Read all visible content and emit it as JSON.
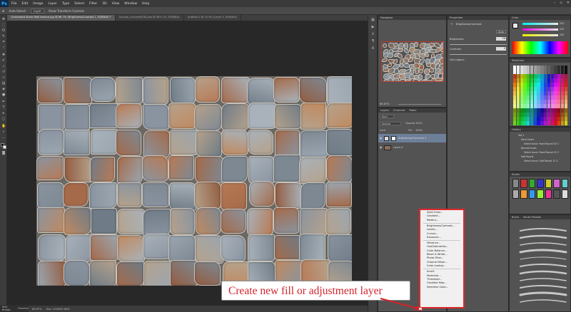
{
  "menubar": {
    "logo": "Ps",
    "items": [
      "File",
      "Edit",
      "Image",
      "Layer",
      "Type",
      "Select",
      "Filter",
      "3D",
      "View",
      "Window",
      "Help"
    ],
    "window_controls": [
      "–",
      "▫",
      "✕"
    ]
  },
  "options": {
    "items": [
      "Auto-Select:",
      "Layer",
      "Show Transform Controls"
    ]
  },
  "tabs": [
    {
      "label": "Contrasted Stone Wall texture.jpg @ 66.7% (Brightness/Contrast 1, RGB/8#) *",
      "active": true
    },
    {
      "label": "Grunge_Concrete[T6].psd @ 58% (T1, RGB/8#)",
      "active": false
    },
    {
      "label": "Untitled-1 @ 13.3% (Layer 1, RGB/8#)",
      "active": false
    }
  ],
  "status": {
    "zoom": "66.67%",
    "doc": "Doc: 4.80M/9.60M",
    "bottom_tab": "Mini Bridge",
    "bottom_tab2": "Timeline"
  },
  "navigator": {
    "title": "Navigator",
    "zoom": "66.67%"
  },
  "layers": {
    "tabs": [
      "Layers",
      "Channels",
      "Paths"
    ],
    "kind": "Kind",
    "blend": "Normal",
    "opacity_label": "Opacity:",
    "opacity": "100%",
    "lock_label": "Lock:",
    "fill_label": "Fill:",
    "fill": "100%",
    "rows": [
      {
        "name": "Brightness/Contrast 1"
      },
      {
        "name": "Layer 0"
      }
    ]
  },
  "properties": {
    "title": "Properties",
    "subtitle": "Brightness/Contrast",
    "auto": "Auto",
    "brightness_label": "Brightness:",
    "brightness": "28",
    "contrast_label": "Contrast:",
    "contrast": "0",
    "legacy": "Use Legacy"
  },
  "color": {
    "title": "Color",
    "r": "232",
    "g": "232",
    "b": "232"
  },
  "swatches": {
    "title": "Swatches"
  },
  "history": {
    "title": "History",
    "items": [
      "Set 1",
      "Hard Invert",
      "Select brush 'Hard Round 30 1'",
      "Normal brush",
      "Select brush 'Hard Round 13 1'",
      "Soft Round",
      "Select brush 'Soft Round 13 1'"
    ]
  },
  "styles": {
    "title": "Styles"
  },
  "brush": {
    "tabs": [
      "Brush",
      "Brush Presets"
    ]
  },
  "menu": {
    "groups": [
      [
        "Solid Color...",
        "Gradient...",
        "Pattern..."
      ],
      [
        "Brightness/Contrast...",
        "Levels...",
        "Curves...",
        "Exposure..."
      ],
      [
        "Vibrance...",
        "Hue/Saturation...",
        "Color Balance...",
        "Black & White...",
        "Photo Filter...",
        "Channel Mixer...",
        "Color Lookup..."
      ],
      [
        "Invert",
        "Posterize...",
        "Threshold...",
        "Gradient Map...",
        "Selective Color..."
      ]
    ]
  },
  "callout": {
    "text": "Create new fill or adjustment layer"
  },
  "colors": {
    "callout_text": "#d2232a",
    "callout_border": "#e0282e"
  }
}
